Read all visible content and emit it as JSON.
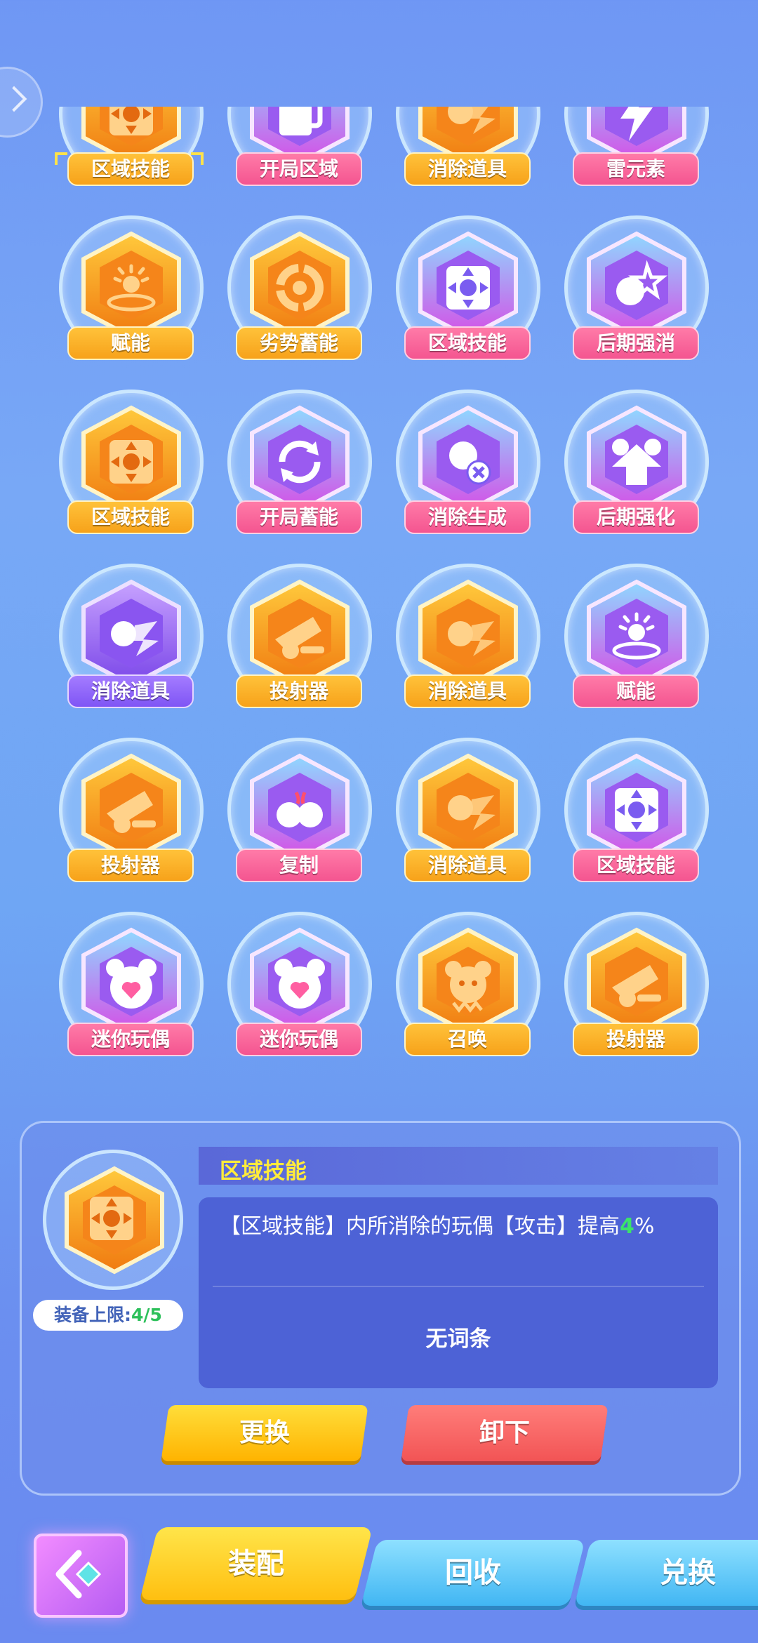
{
  "colors": {
    "orange": "#f7a21a",
    "pink": "#f45590",
    "purple": "#7f55f5",
    "highlight_green": "#3be36a",
    "title_yellow": "#ffeb3b"
  },
  "skills": [
    {
      "label": "区域技能",
      "color": "orange",
      "icon": "target-grid-icon",
      "selected": true
    },
    {
      "label": "开局区域",
      "color": "pink",
      "icon": "squares-icon"
    },
    {
      "label": "消除道具",
      "color": "orange",
      "icon": "ball-bolt-icon"
    },
    {
      "label": "雷元素",
      "color": "pink",
      "icon": "lightning-icon"
    },
    {
      "label": "赋能",
      "color": "orange",
      "icon": "sun-ring-icon"
    },
    {
      "label": "劣势蓄能",
      "color": "orange",
      "icon": "ring-icon"
    },
    {
      "label": "区域技能",
      "color": "pink",
      "icon": "target-grid-icon"
    },
    {
      "label": "后期强消",
      "color": "pink",
      "icon": "star-ball-icon"
    },
    {
      "label": "区域技能",
      "color": "orange",
      "icon": "target-grid-icon"
    },
    {
      "label": "开局蓄能",
      "color": "pink",
      "icon": "cycle-icon"
    },
    {
      "label": "消除生成",
      "color": "pink",
      "icon": "ball-cross-icon"
    },
    {
      "label": "后期强化",
      "color": "pink",
      "icon": "bear-arrow-icon"
    },
    {
      "label": "消除道具",
      "color": "purple",
      "icon": "ball-bolt-icon"
    },
    {
      "label": "投射器",
      "color": "orange",
      "icon": "cannon-icon"
    },
    {
      "label": "消除道具",
      "color": "orange",
      "icon": "ball-bolt-icon"
    },
    {
      "label": "赋能",
      "color": "pink",
      "icon": "sun-ring-icon"
    },
    {
      "label": "投射器",
      "color": "orange",
      "icon": "cannon-icon"
    },
    {
      "label": "复制",
      "color": "pink",
      "icon": "double-ball-icon"
    },
    {
      "label": "消除道具",
      "color": "orange",
      "icon": "ball-bolt-icon"
    },
    {
      "label": "区域技能",
      "color": "pink",
      "icon": "target-grid-icon"
    },
    {
      "label": "迷你玩偶",
      "color": "pink",
      "icon": "bear-heart-icon"
    },
    {
      "label": "迷你玩偶",
      "color": "pink",
      "icon": "bear-heart-icon"
    },
    {
      "label": "召唤",
      "color": "orange",
      "icon": "bear-icon"
    },
    {
      "label": "投射器",
      "color": "orange",
      "icon": "cannon-icon"
    }
  ],
  "detail": {
    "title": "区域技能",
    "icon": "target-grid-icon",
    "description_prefix": "【区域技能】内所消除的玩偶【攻击】提高",
    "description_value": "4",
    "description_suffix": "%",
    "no_entry": "无词条",
    "limit_label": "装备上限:",
    "limit_value": "4/5",
    "change_button": "更换",
    "remove_button": "卸下"
  },
  "bottom_tabs": {
    "equip": "装配",
    "recycle": "回收",
    "exchange": "兑换"
  }
}
